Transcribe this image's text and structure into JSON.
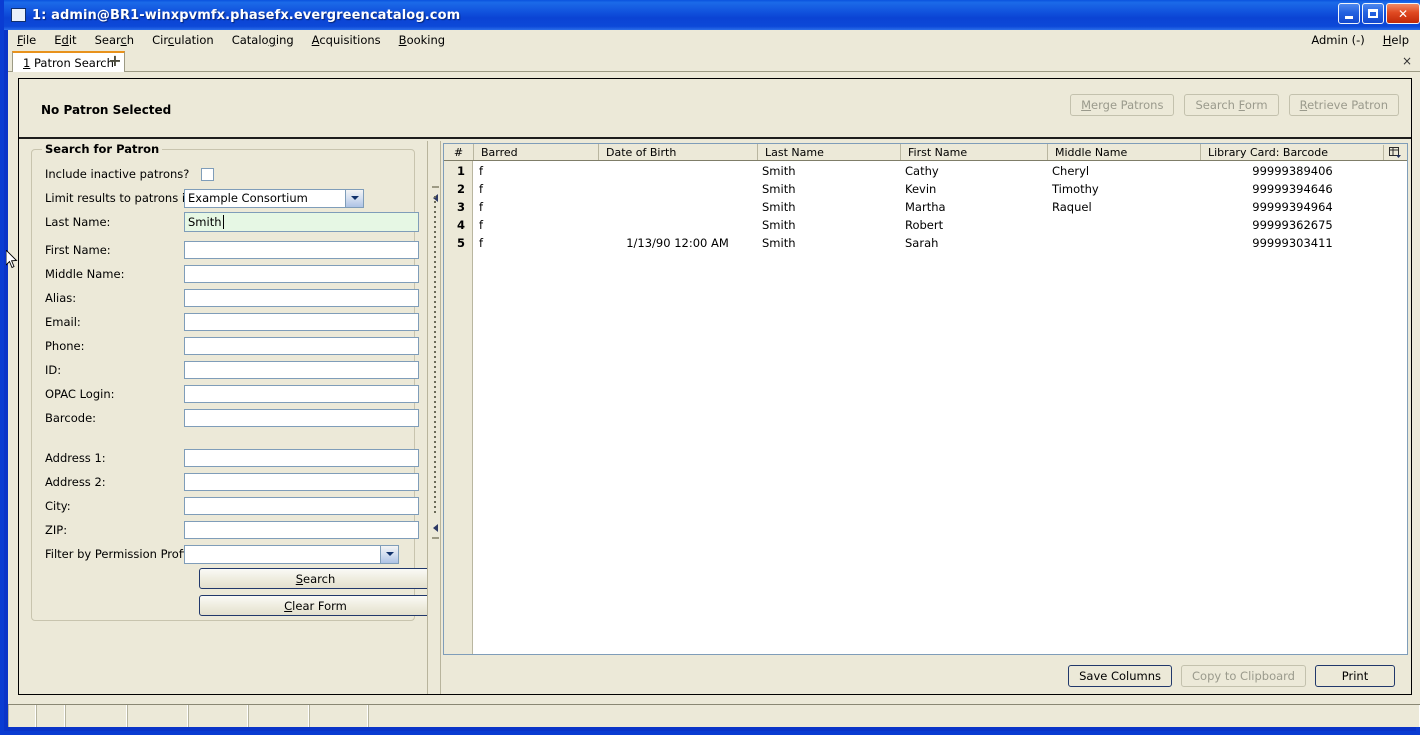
{
  "window": {
    "title": "1: admin@BR1-winxpvmfx.phasefx.evergreencatalog.com",
    "minimize_label": "Minimize",
    "maximize_label": "Maximize",
    "close_label": "✕"
  },
  "menubar": {
    "items": [
      {
        "label": "File",
        "accel": "F"
      },
      {
        "label": "Edit",
        "accel": "E"
      },
      {
        "label": "Search",
        "accel": "c"
      },
      {
        "label": "Circulation",
        "accel": "C"
      },
      {
        "label": "Cataloging",
        "accel": "g"
      },
      {
        "label": "Acquisitions",
        "accel": "A"
      },
      {
        "label": "Booking",
        "accel": "B"
      }
    ],
    "right": [
      {
        "label": "Admin (-)"
      },
      {
        "label": "Help"
      }
    ]
  },
  "tabs": {
    "items": [
      {
        "label": "1 Patron Search"
      }
    ],
    "new_tab_label": "+",
    "close_all_label": "×"
  },
  "patron_header": {
    "status": "No Patron Selected",
    "buttons": [
      {
        "label": "Merge Patrons",
        "disabled": true
      },
      {
        "label": "Search Form",
        "disabled": true
      },
      {
        "label": "Retrieve Patron",
        "disabled": true
      }
    ]
  },
  "search_form": {
    "legend": "Search for Patron",
    "fields": [
      {
        "label": "Include inactive patrons?",
        "type": "checkbox",
        "value": "",
        "checked": false
      },
      {
        "label": "Limit results to patrons in",
        "type": "select",
        "value": "Example Consortium"
      },
      {
        "label": "Last Name:",
        "type": "text",
        "value": "Smith",
        "active": true
      },
      {
        "label": "First Name:",
        "type": "text",
        "value": ""
      },
      {
        "label": "Middle Name:",
        "type": "text",
        "value": ""
      },
      {
        "label": "Alias:",
        "type": "text",
        "value": ""
      },
      {
        "label": "Email:",
        "type": "text",
        "value": ""
      },
      {
        "label": "Phone:",
        "type": "text",
        "value": ""
      },
      {
        "label": "ID:",
        "type": "text",
        "value": ""
      },
      {
        "label": "OPAC Login:",
        "type": "text",
        "value": ""
      },
      {
        "label": "Barcode:",
        "type": "text",
        "value": ""
      },
      {
        "label": "Address 1:",
        "type": "text",
        "value": ""
      },
      {
        "label": "Address 2:",
        "type": "text",
        "value": ""
      },
      {
        "label": "City:",
        "type": "text",
        "value": ""
      },
      {
        "label": "ZIP:",
        "type": "text",
        "value": ""
      },
      {
        "label": "Filter by Permission Profile:",
        "type": "select",
        "value": ""
      }
    ],
    "search_button": "Search",
    "clear_button": "Clear Form"
  },
  "results": {
    "columns": [
      {
        "label": "#"
      },
      {
        "label": "Barred"
      },
      {
        "label": "Date of Birth"
      },
      {
        "label": "Last Name"
      },
      {
        "label": "First Name"
      },
      {
        "label": "Middle Name"
      },
      {
        "label": "Library Card: Barcode"
      }
    ],
    "rows": [
      {
        "num": "1",
        "barred": "f",
        "dob": "",
        "last": "Smith",
        "first": "Cathy",
        "middle": "Cheryl",
        "barcode": "99999389406"
      },
      {
        "num": "2",
        "barred": "f",
        "dob": "",
        "last": "Smith",
        "first": "Kevin",
        "middle": "Timothy",
        "barcode": "99999394646"
      },
      {
        "num": "3",
        "barred": "f",
        "dob": "",
        "last": "Smith",
        "first": "Martha",
        "middle": "Raquel",
        "barcode": "99999394964"
      },
      {
        "num": "4",
        "barred": "f",
        "dob": "",
        "last": "Smith",
        "first": "Robert",
        "middle": "",
        "barcode": "99999362675"
      },
      {
        "num": "5",
        "barred": "f",
        "dob": "1/13/90 12:00 AM",
        "last": "Smith",
        "first": "Sarah",
        "middle": "",
        "barcode": "99999303411"
      }
    ],
    "footer_buttons": [
      {
        "label": "Save Columns",
        "disabled": false,
        "default": true
      },
      {
        "label": "Copy to Clipboard",
        "disabled": true,
        "default": false
      },
      {
        "label": "Print",
        "disabled": false,
        "default": true
      }
    ],
    "column_picker_icon": "column-picker-icon"
  },
  "colors": {
    "window_bg": "#ECE9D8",
    "title_blue": "#0A52DE",
    "tab_accent": "#E8921C",
    "active_field_green": "#E6F7E4",
    "field_border": "#7F9DB9"
  }
}
